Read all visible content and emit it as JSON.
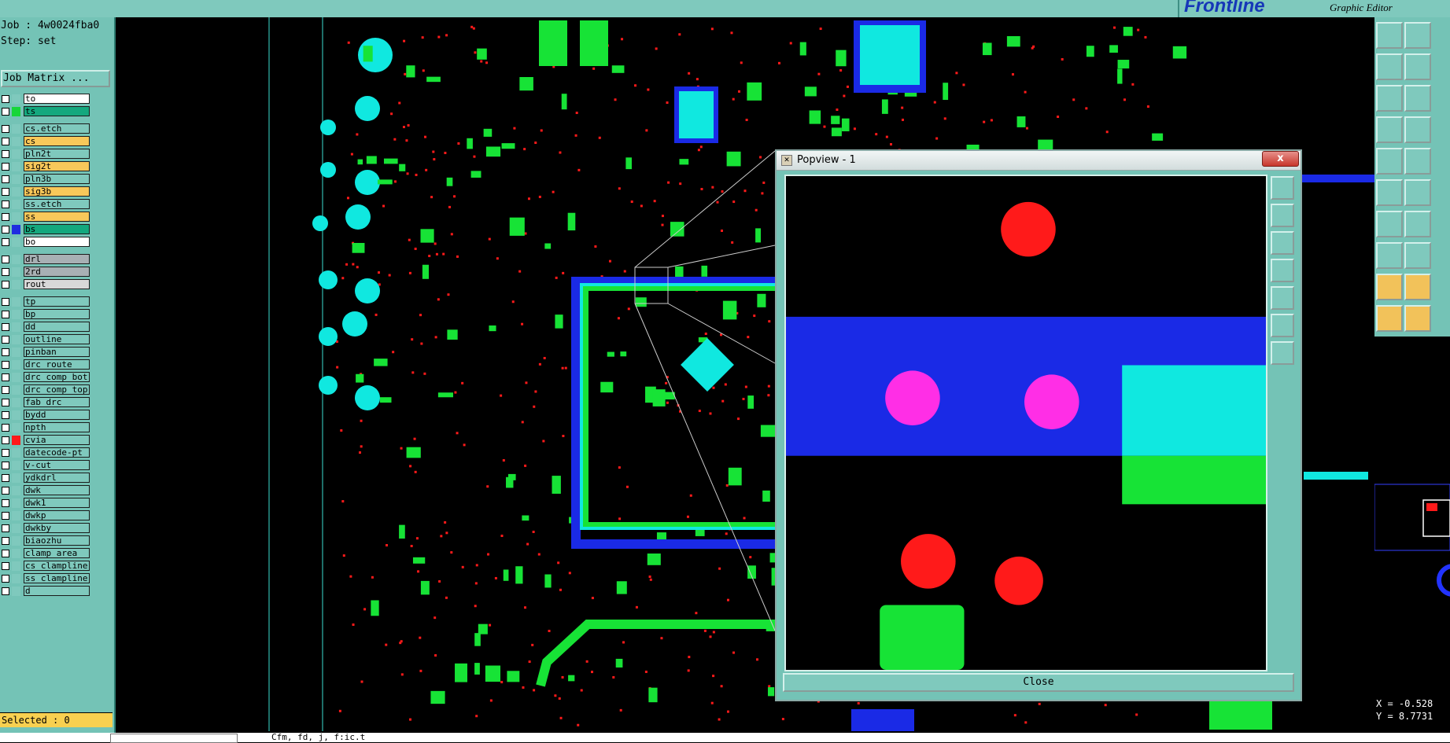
{
  "brand": {
    "logo": "Frontline",
    "subtitle": "Graphic Editor"
  },
  "job": {
    "label": "Job : 4w0024fba0",
    "step": "Step: set",
    "matrix_button": "Job Matrix ..."
  },
  "layers": [
    {
      "name": "to",
      "color": "#ffffff",
      "swatch": ""
    },
    {
      "name": "ts",
      "color": "#14a87e",
      "swatch": "#17d63a"
    },
    {
      "name": "cs.etch",
      "color": "#7fc9bd",
      "swatch": ""
    },
    {
      "name": "cs",
      "color": "#f8c85a",
      "swatch": ""
    },
    {
      "name": "pln2t",
      "color": "#7fc9bd",
      "swatch": ""
    },
    {
      "name": "sig2t",
      "color": "#f8c85a",
      "swatch": ""
    },
    {
      "name": "pln3b",
      "color": "#7fc9bd",
      "swatch": ""
    },
    {
      "name": "sig3b",
      "color": "#f8c85a",
      "swatch": ""
    },
    {
      "name": "ss.etch",
      "color": "#7fc9bd",
      "swatch": ""
    },
    {
      "name": "ss",
      "color": "#f8c85a",
      "swatch": ""
    },
    {
      "name": "bs",
      "color": "#14a87e",
      "swatch": "#1f2de0"
    },
    {
      "name": "bo",
      "color": "#ffffff",
      "swatch": ""
    },
    {
      "name": "drl",
      "color": "#a8b0b4",
      "swatch": ""
    },
    {
      "name": "2rd",
      "color": "#a8b0b4",
      "swatch": ""
    },
    {
      "name": "rout",
      "color": "#d8d8d8",
      "swatch": ""
    },
    {
      "name": "tp",
      "color": "#7fc9bd",
      "swatch": ""
    },
    {
      "name": "bp",
      "color": "#7fc9bd",
      "swatch": ""
    },
    {
      "name": "dd",
      "color": "#7fc9bd",
      "swatch": ""
    },
    {
      "name": "outline",
      "color": "#7fc9bd",
      "swatch": ""
    },
    {
      "name": "pinban",
      "color": "#7fc9bd",
      "swatch": ""
    },
    {
      "name": "drc_route",
      "color": "#7fc9bd",
      "swatch": ""
    },
    {
      "name": "drc_comp_bot",
      "color": "#7fc9bd",
      "swatch": ""
    },
    {
      "name": "drc_comp_top",
      "color": "#7fc9bd",
      "swatch": ""
    },
    {
      "name": "fab_drc",
      "color": "#7fc9bd",
      "swatch": ""
    },
    {
      "name": "bydd",
      "color": "#7fc9bd",
      "swatch": ""
    },
    {
      "name": "npth",
      "color": "#7fc9bd",
      "swatch": ""
    },
    {
      "name": "cvia",
      "color": "#7fc9bd",
      "swatch": "#ff1a1a"
    },
    {
      "name": "datecode-pt",
      "color": "#7fc9bd",
      "swatch": ""
    },
    {
      "name": "v-cut",
      "color": "#7fc9bd",
      "swatch": ""
    },
    {
      "name": "ydkdrl",
      "color": "#7fc9bd",
      "swatch": ""
    },
    {
      "name": "dwk",
      "color": "#7fc9bd",
      "swatch": ""
    },
    {
      "name": "dwk1",
      "color": "#7fc9bd",
      "swatch": ""
    },
    {
      "name": "dwkp",
      "color": "#7fc9bd",
      "swatch": ""
    },
    {
      "name": "dwkby",
      "color": "#7fc9bd",
      "swatch": ""
    },
    {
      "name": "biaozhu",
      "color": "#7fc9bd",
      "swatch": ""
    },
    {
      "name": "clamp_area",
      "color": "#7fc9bd",
      "swatch": ""
    },
    {
      "name": "cs_clampline",
      "color": "#7fc9bd",
      "swatch": ""
    },
    {
      "name": "ss_clampline",
      "color": "#7fc9bd",
      "swatch": ""
    },
    {
      "name": "d",
      "color": "#7fc9bd",
      "swatch": ""
    }
  ],
  "status": {
    "selected": "Selected : 0",
    "message": "Cfm, fd, j, f:ic.t"
  },
  "popview": {
    "title": "Popview - 1",
    "close_x": "x",
    "close_button": "Close"
  },
  "coords": {
    "x": "X = -0.528",
    "y": "Y = 8.7731"
  },
  "colors": {
    "panel": "#74c3b6",
    "copper_green": "#17e336",
    "plane_blue": "#1a2ae6",
    "via_red": "#ff1a1a",
    "pad_cyan": "#10e8e0",
    "pad_magenta": "#ff2ee6"
  }
}
